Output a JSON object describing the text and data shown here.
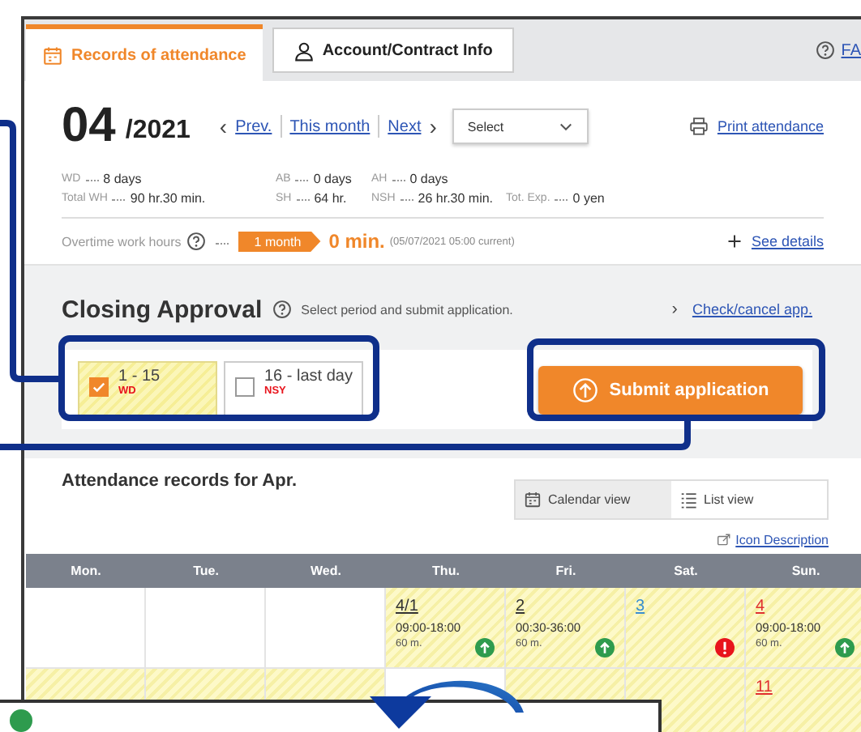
{
  "tabs": [
    {
      "label": "Records of attendance",
      "selected": true,
      "kind": "calendar"
    },
    {
      "label": "Account/Contract Info",
      "selected": false,
      "kind": "person"
    }
  ],
  "help_link": "FA",
  "period": {
    "month": "04",
    "year": "/2021",
    "prev_chevron": "‹",
    "nav": [
      "Prev.",
      "This month",
      "Next"
    ],
    "next_chevron": "›",
    "select": {
      "placeholder": "Select"
    },
    "print": "Print attendance"
  },
  "summary": [
    [
      {
        "label": "WD",
        "value": "8 days"
      },
      {
        "label": "AB",
        "value": "0 days"
      },
      {
        "label": "AH",
        "value": "0 days"
      }
    ],
    [
      {
        "label": "Total WH",
        "value": "90 hr.30 min."
      },
      {
        "label": "SH",
        "value": "64 hr."
      },
      {
        "label": "NSH",
        "value": "26 hr.30 min."
      },
      {
        "label": "Tot. Exp.",
        "value": "0 yen"
      }
    ]
  ],
  "overtime": {
    "label": "Overtime work hours",
    "badge": "1 month",
    "value": "0 min.",
    "note": "(05/07/2021 05:00 current)",
    "details": "See details"
  },
  "closing": {
    "title": "Closing Approval",
    "hint": "Select period and submit application.",
    "link_chevron": "›",
    "link": "Check/cancel app.",
    "periods": [
      {
        "label": "1 - 15",
        "status": "WD",
        "checked": true
      },
      {
        "label": "16 - last day",
        "status": "NSY",
        "checked": false
      }
    ],
    "submit": "Submit application"
  },
  "records": {
    "title": "Attendance records for Apr.",
    "views": [
      {
        "label": "Calendar view",
        "selected": true,
        "kind": "calendar"
      },
      {
        "label": "List view",
        "selected": false,
        "kind": "list"
      }
    ],
    "icon_link": "Icon Description",
    "weekdays": [
      "Mon.",
      "Tue.",
      "Wed.",
      "Thu.",
      "Fri.",
      "Sat.",
      "Sun."
    ],
    "weeks": [
      [
        {
          "highlighted": false
        },
        {
          "highlighted": false
        },
        {
          "highlighted": false
        },
        {
          "highlighted": true,
          "day": "4/1",
          "color": "#333333",
          "time": "09:00-18:00",
          "break": "60 m.",
          "icon": {
            "kind": "up"
          }
        },
        {
          "highlighted": true,
          "day": "2",
          "color": "#333333",
          "time": "00:30-36:00",
          "break": "60 m.",
          "icon": {
            "kind": "up"
          }
        },
        {
          "highlighted": true,
          "day": "3",
          "color": "#3a8fd0",
          "icon": {
            "kind": "alert"
          }
        },
        {
          "highlighted": true,
          "day": "4",
          "color": "#e03030",
          "time": "09:00-18:00",
          "break": "60 m.",
          "icon": {
            "kind": "up"
          }
        }
      ],
      [
        {
          "highlighted": true
        },
        {
          "highlighted": true
        },
        {
          "highlighted": true
        },
        {
          "highlighted": false
        },
        {
          "highlighted": true
        },
        {
          "highlighted": true
        },
        {
          "highlighted": true,
          "day": "11",
          "color": "#e03030"
        }
      ]
    ]
  }
}
